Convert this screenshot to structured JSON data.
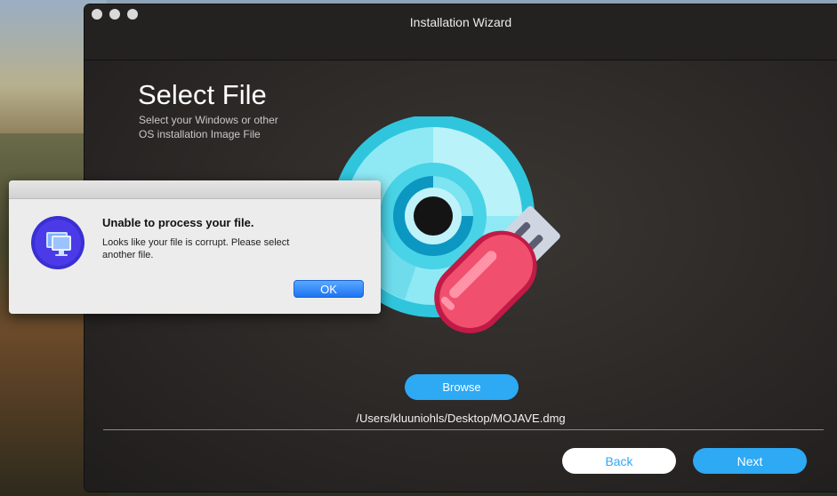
{
  "window": {
    "title": "Installation Wizard"
  },
  "page": {
    "heading": "Select File",
    "subheading": "Select your Windows or other OS installation Image File"
  },
  "illustration": {
    "icons": [
      "disc-icon",
      "usb-drive-icon"
    ]
  },
  "file_picker": {
    "browse_label": "Browse",
    "selected_path": "/Users/kluuniohls/Desktop/MOJAVE.dmg"
  },
  "footer": {
    "back_label": "Back",
    "next_label": "Next"
  },
  "alert": {
    "title": "Unable to process your file.",
    "message": "Looks like your file is corrupt. Please select\nanother  file.",
    "ok_label": "OK",
    "icon": "monitor-app-icon"
  },
  "colors": {
    "accent": "#2ea9f3",
    "alert_button": "#1d74f2",
    "window_bg": "#2b2826"
  }
}
